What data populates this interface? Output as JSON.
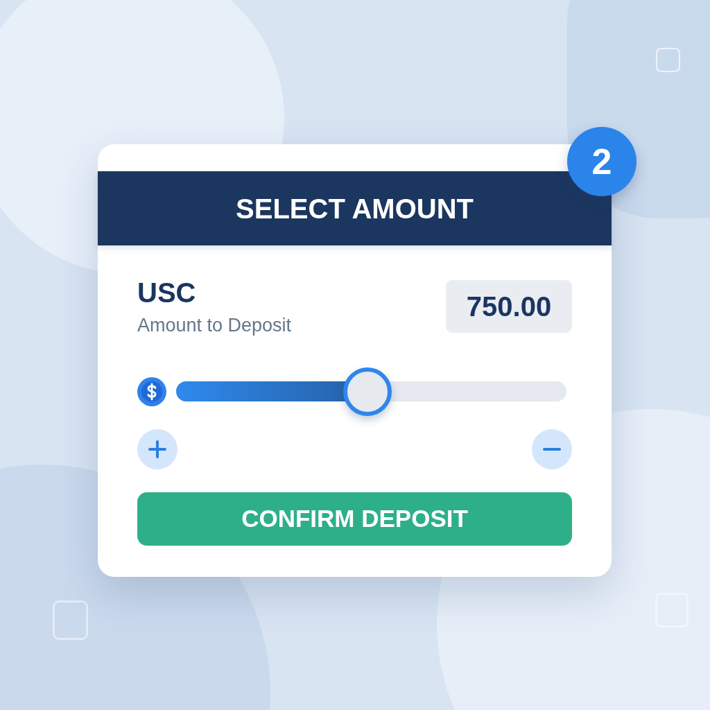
{
  "header": {
    "title": "SELECT AMOUNT"
  },
  "badge": {
    "text": "2"
  },
  "currency": {
    "code": "USC",
    "label": "Amount to Deposit"
  },
  "amount_field": {
    "value": "750.00"
  },
  "slider": {
    "level": 0.49
  },
  "confirm_button": {
    "label": "CONFIRM DEPOSIT"
  }
}
